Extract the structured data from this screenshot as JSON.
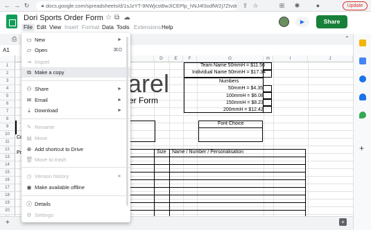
{
  "browser": {
    "url": "docs.google.com/spreadsheets/d/1sJzYT-9NWjcst8wJICEPlp_hNJ4f3odfW2j7ZtvdcU/edit#gid=0",
    "update_label": "Update"
  },
  "app": {
    "title": "Dori Sports Order Form",
    "share_label": "Share",
    "menus": [
      "File",
      "Edit",
      "View",
      "Insert",
      "Format",
      "Data",
      "Tools",
      "Extensions",
      "Help"
    ],
    "namebox": "A1"
  },
  "grid": {
    "columns": [
      "D",
      "E",
      "F",
      "G",
      "H",
      "I",
      "J"
    ],
    "rows": [
      "1",
      "2",
      "3",
      "4",
      "5",
      "6",
      "7",
      "8",
      "9",
      "10",
      "11",
      "12",
      "13",
      "14",
      "15",
      "16",
      "17",
      "18",
      "19",
      "20",
      "21"
    ],
    "big_word": "arel",
    "sub_word": "er Form",
    "price_lines": [
      "Team Name 50mmH = $11.56",
      "Individual Name 50mmH = $17.34"
    ],
    "numbers_header": "Numbers",
    "number_prices": [
      "50mmH = $4.35",
      "100mmH = $6.08",
      "150mmH = $8.23",
      "200mmH = $12.42"
    ],
    "font_choice": "Font Choice",
    "table_headers": {
      "size": "Size",
      "name": "Name / Number / Personalisation"
    },
    "left_fragments": {
      "co": "Co",
      "pr": "Pr"
    }
  },
  "file_menu": {
    "items": [
      {
        "label": "New",
        "icon": "new-file-icon",
        "arrow": "►"
      },
      {
        "label": "Open",
        "icon": "open-folder-icon",
        "shortcut": "⌘O"
      },
      {
        "label": "Import",
        "icon": "import-icon",
        "disabled": true
      },
      {
        "label": "Make a copy",
        "icon": "copy-icon"
      },
      {
        "label": "Share",
        "icon": "share-icon",
        "arrow": "►"
      },
      {
        "label": "Email",
        "icon": "email-icon",
        "arrow": "►"
      },
      {
        "label": "Download",
        "icon": "download-icon",
        "arrow": "►"
      },
      {
        "label": "Rename",
        "icon": "rename-icon",
        "disabled": true
      },
      {
        "label": "Move",
        "icon": "move-icon",
        "disabled": true
      },
      {
        "label": "Add shortcut to Drive",
        "icon": "shortcut-icon"
      },
      {
        "label": "Move to trash",
        "icon": "trash-icon",
        "disabled": true
      },
      {
        "label": "Version history",
        "icon": "history-icon",
        "arrow": "►",
        "disabled": true
      },
      {
        "label": "Make available offline",
        "icon": "offline-icon"
      },
      {
        "label": "Details",
        "icon": "info-icon"
      },
      {
        "label": "Settings",
        "icon": "settings-icon",
        "disabled": true
      }
    ]
  },
  "colors": {
    "share_green": "#188038",
    "sheets_green": "#0f9d58",
    "update_red": "#d93025"
  }
}
